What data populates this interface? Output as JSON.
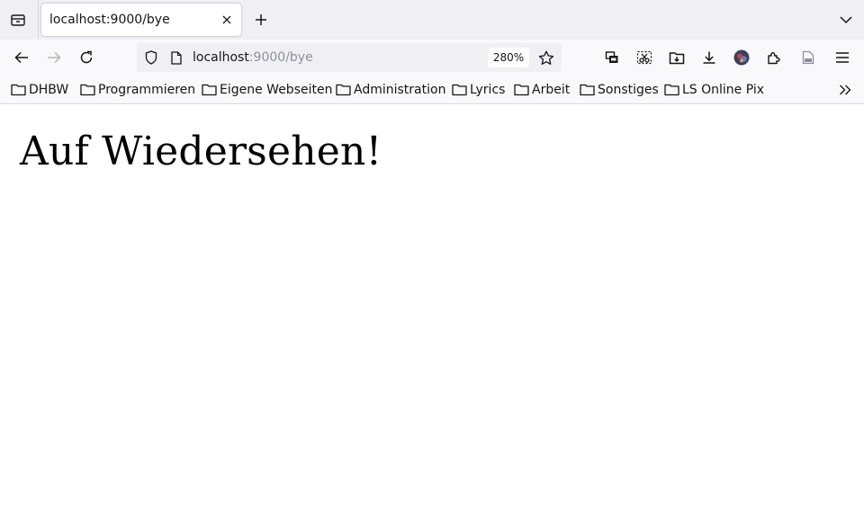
{
  "browser": {
    "tab": {
      "title": "localhost:9000/bye"
    },
    "url": {
      "host": "localhost",
      "path": ":9000/bye",
      "zoom": "280%"
    },
    "bookmarks": [
      {
        "label": "DHBW"
      },
      {
        "label": "Programmieren"
      },
      {
        "label": "Eigene Webseiten"
      },
      {
        "label": "Administration"
      },
      {
        "label": "Lyrics"
      },
      {
        "label": "Arbeit"
      },
      {
        "label": "Sonstiges"
      },
      {
        "label": "LS Online Pix"
      }
    ],
    "colors": {
      "tabstrip": "#f0f0f4",
      "toolbar": "#f9f9fb",
      "urlbar": "#f0f0f4",
      "text": "#15141a",
      "dim_text": "#8f8f9d"
    },
    "icons": [
      "tab-list-icon",
      "close-icon",
      "plus-icon",
      "chevron-down-icon",
      "back-arrow-icon",
      "forward-arrow-icon",
      "reload-icon",
      "shield-icon",
      "page-icon",
      "star-icon",
      "screenshot-icon",
      "cut-icon",
      "folder-download-icon",
      "download-icon",
      "avatar-icon",
      "extensions-icon",
      "document-icon",
      "hamburger-menu-icon",
      "folder-icon",
      "double-chevron-right-icon"
    ]
  },
  "page": {
    "heading": "Auf Wiedersehen!"
  }
}
